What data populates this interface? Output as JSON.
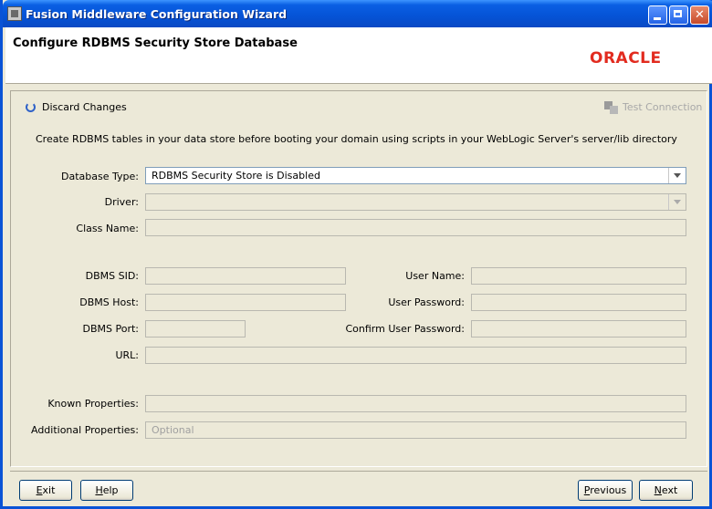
{
  "window": {
    "title": "Fusion Middleware Configuration Wizard"
  },
  "header": {
    "title": "Configure RDBMS Security Store Database",
    "logo": "ORACLE"
  },
  "toolbar": {
    "discard_label": "Discard Changes",
    "test_label": "Test Connection"
  },
  "instructions": "Create RDBMS tables in your data store before booting your domain using scripts in your WebLogic Server's server/lib directory",
  "form": {
    "database_type": {
      "label": "Database Type:",
      "value": "RDBMS Security Store is Disabled"
    },
    "driver": {
      "label": "Driver:",
      "value": ""
    },
    "class_name": {
      "label": "Class Name:",
      "value": ""
    },
    "dbms_sid": {
      "label": "DBMS SID:",
      "value": ""
    },
    "dbms_host": {
      "label": "DBMS Host:",
      "value": ""
    },
    "dbms_port": {
      "label": "DBMS Port:",
      "value": ""
    },
    "user_name": {
      "label": "User Name:",
      "value": ""
    },
    "user_password": {
      "label": "User Password:",
      "value": ""
    },
    "confirm_password": {
      "label": "Confirm User Password:",
      "value": ""
    },
    "url": {
      "label": "URL:",
      "value": ""
    },
    "known_properties": {
      "label": "Known Properties:",
      "value": ""
    },
    "additional_properties": {
      "label": "Additional Properties:",
      "placeholder": "Optional"
    }
  },
  "buttons": {
    "exit": {
      "pre": "",
      "ul": "E",
      "post": "xit"
    },
    "help": {
      "pre": "",
      "ul": "H",
      "post": "elp"
    },
    "previous": {
      "pre": "",
      "ul": "P",
      "post": "revious"
    },
    "next": {
      "pre": "",
      "ul": "N",
      "post": "ext"
    }
  },
  "colors": {
    "titlebar": "#0553d6",
    "oracle_red": "#e22b1f",
    "panel": "#ece9d8"
  }
}
